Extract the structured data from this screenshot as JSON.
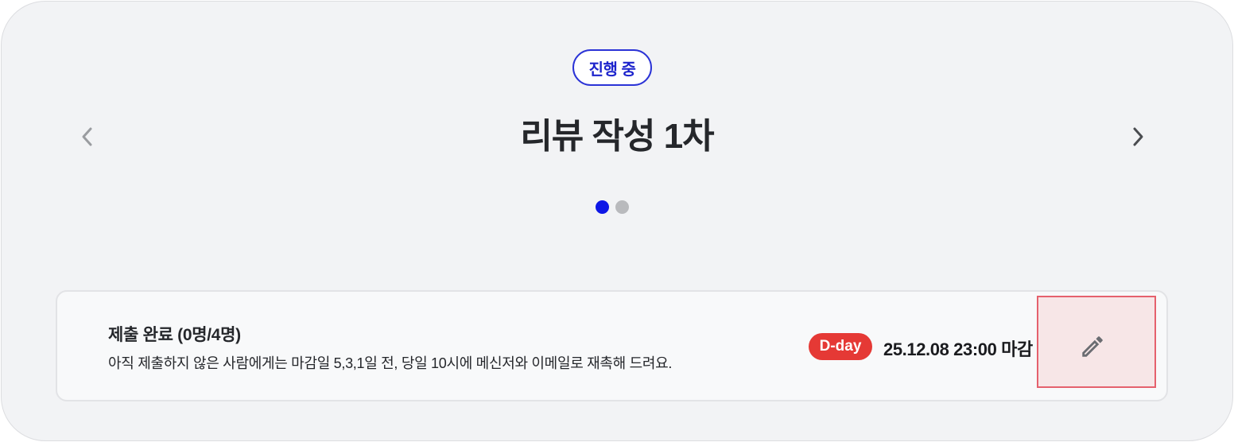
{
  "header": {
    "status_badge": "진행 중",
    "title": "리뷰 작성 1차",
    "prev_icon": "chevron-left-icon",
    "next_icon": "chevron-right-icon"
  },
  "pagination": {
    "total": 2,
    "active": 1
  },
  "submission": {
    "title": "제출 완료 (0명/4명)",
    "description": "아직 제출하지 않은 사람에게는 마감일 5,3,1일 전, 당일 10시에 메신저와 이메일로 재촉해 드려요.",
    "dday_label": "D-day",
    "deadline": "25.12.08 23:00 마감",
    "edit_icon": "pencil-icon"
  },
  "colors": {
    "accent": "#0e17e6",
    "badge_border": "#2b33d6",
    "dday": "#e53935",
    "highlight_border": "#e5616d"
  }
}
